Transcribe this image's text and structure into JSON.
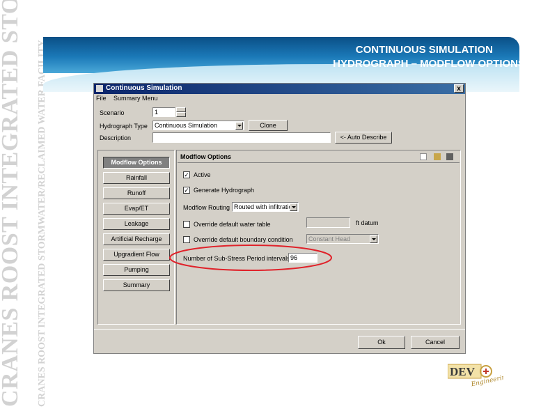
{
  "slide": {
    "title_line1": "CONTINUOUS SIMULATION",
    "title_line2": "HYDROGRAPH – MODFLOW OPTIONS",
    "watermark_line1": "CRANES ROOST INTEGRATED STORMWATER",
    "watermark_line2": "CRANES ROOST INTEGRATED STORMWATER/RECLAIMED WATER FACILITY",
    "logo_text": "DEV",
    "logo_script": "Engineering",
    "colors": {
      "banner": "#1b79b8",
      "highlight_ellipse": "#e0222a",
      "logo_gold": "#c8a040",
      "logo_red": "#c0392b"
    }
  },
  "window": {
    "title": "Continuous Simulation",
    "close_label": "x",
    "menu": [
      "File",
      "Summary Menu"
    ],
    "scenario_label": "Scenario",
    "scenario_value": "1",
    "hydrograph_type_label": "Hydrograph Type",
    "hydrograph_type_value": "Continuous Simulation",
    "clone_label": "Clone",
    "description_label": "Description",
    "description_value": "",
    "auto_describe_label": "<- Auto Describe",
    "nav": [
      "Modflow Options",
      "Rainfall",
      "Runoff",
      "Evap/ET",
      "Leakage",
      "Artificial Recharge",
      "Upgradient Flow",
      "Pumping",
      "Summary"
    ],
    "panel": {
      "heading": "Modflow Options",
      "active_label": "Active",
      "active_checked": "✓",
      "generate_label": "Generate Hydrograph",
      "generate_checked": "✓",
      "routing_label": "Modflow Routing",
      "routing_value": "Routed with infiltratio",
      "override_wt_label": "Override default water table",
      "override_wt_value": "",
      "ft_datum_label": "ft datum",
      "override_bc_label": "Override default boundary condition",
      "bc_value": "Constant Head",
      "substress_label": "Number of Sub-Stress Period intervals",
      "substress_value": "96"
    },
    "ok_label": "Ok",
    "cancel_label": "Cancel"
  }
}
